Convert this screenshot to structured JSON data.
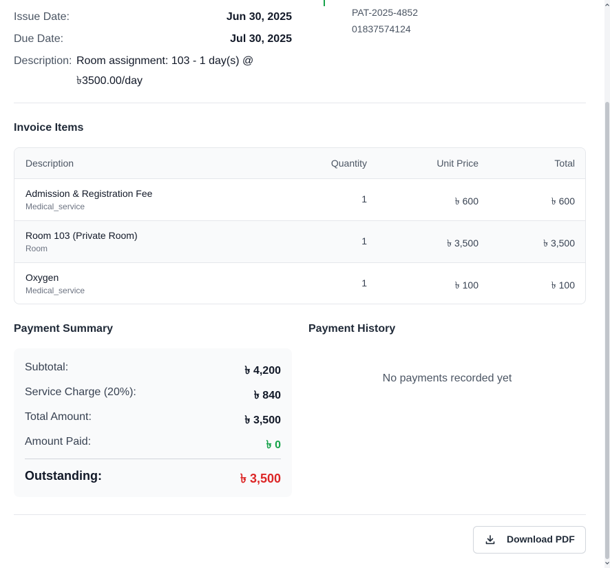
{
  "invoice_info": {
    "issue_date_label": "Issue Date:",
    "issue_date": "Jun 30, 2025",
    "due_date_label": "Due Date:",
    "due_date": "Jul 30, 2025",
    "description_label": "Description:",
    "description_line1": "Room assignment: 103 - 1 day(s) @",
    "description_line2": "৳3500.00/day"
  },
  "patient": {
    "id": "PAT-2025-4852",
    "phone": "01837574124"
  },
  "items": {
    "title": "Invoice Items",
    "headers": [
      "Description",
      "Quantity",
      "Unit Price",
      "Total"
    ],
    "rows": [
      {
        "name": "Admission & Registration Fee",
        "category": "Medical_service",
        "quantity": "1",
        "unit_price": "৳ 600",
        "total": "৳ 600"
      },
      {
        "name": "Room 103 (Private Room)",
        "category": "Room",
        "quantity": "1",
        "unit_price": "৳ 3,500",
        "total": "৳ 3,500"
      },
      {
        "name": "Oxygen",
        "category": "Medical_service",
        "quantity": "1",
        "unit_price": "৳ 100",
        "total": "৳ 100"
      }
    ]
  },
  "summary": {
    "title": "Payment Summary",
    "subtotal_label": "Subtotal:",
    "subtotal": "৳ 4,200",
    "service_label": "Service Charge (20%):",
    "service": "৳ 840",
    "total_label": "Total Amount:",
    "total": "৳ 3,500",
    "paid_label": "Amount Paid:",
    "paid": "৳ 0",
    "outstanding_label": "Outstanding:",
    "outstanding": "৳ 3,500"
  },
  "history": {
    "title": "Payment History",
    "empty": "No payments recorded yet"
  },
  "actions": {
    "download_label": "Download PDF"
  },
  "colors": {
    "paid": "#16a34a",
    "outstanding": "#dc2626"
  },
  "icons": {
    "download": "download-icon"
  }
}
